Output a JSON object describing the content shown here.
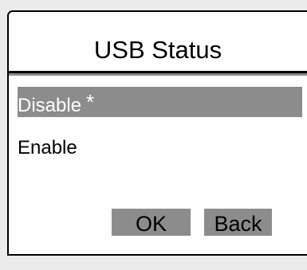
{
  "dialog": {
    "title": "USB Status"
  },
  "options": [
    {
      "label": "Disable",
      "marker": "*",
      "selected": true
    },
    {
      "label": "Enable",
      "marker": "",
      "selected": false
    }
  ],
  "buttons": {
    "ok_label": "OK",
    "back_label": "Back"
  },
  "colors": {
    "background": "#ebebeb",
    "dialog_background": "#ffffff",
    "selection_highlight": "#8c8c8c",
    "button_background": "#8c8c8c",
    "border": "#000000"
  }
}
